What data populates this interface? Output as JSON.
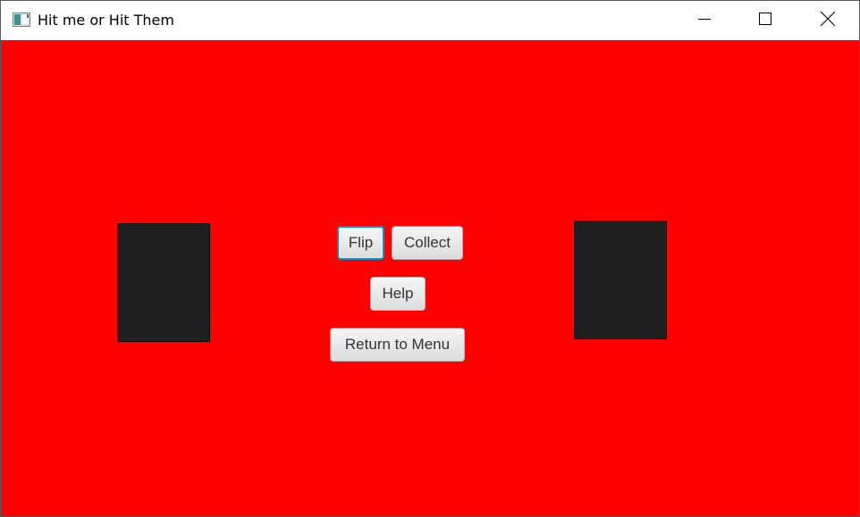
{
  "window": {
    "title": "Hit me or Hit Them",
    "minimize_icon": "minimize-icon",
    "maximize_icon": "maximize-icon",
    "close_icon": "close-icon",
    "app_icon": "app-window-icon"
  },
  "game": {
    "background_color": "#ff0000",
    "card_color": "#1f1f1f",
    "buttons": {
      "flip": "Flip",
      "collect": "Collect",
      "help": "Help",
      "return_to_menu": "Return to Menu"
    },
    "focused_button": "Flip"
  }
}
